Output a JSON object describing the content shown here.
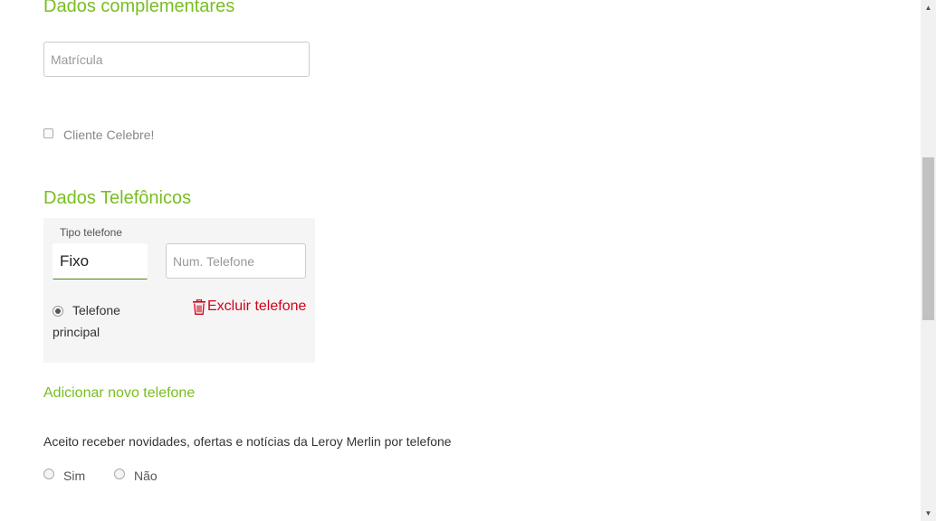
{
  "complementares": {
    "title": "Dados complementares",
    "matricula_placeholder": "Matrícula",
    "cliente_celebre_label": "Cliente Celebre!"
  },
  "telefonicos": {
    "title": "Dados Telefônicos",
    "tipo_label": "Tipo telefone",
    "tipo_value": "Fixo",
    "numero_placeholder": "Num. Telefone",
    "principal_label_line1": "Telefone",
    "principal_label_line2": "principal",
    "excluir_label": "Excluir telefone",
    "add_phone_label": "Adicionar novo telefone"
  },
  "consent": {
    "text": "Aceito receber novidades, ofertas e notícias da Leroy Merlin por telefone",
    "option_yes": "Sim",
    "option_no": "Não"
  },
  "colors": {
    "accent": "#78be20",
    "danger": "#d0021b",
    "card_bg": "#f5f5f5"
  },
  "icons": [
    "trash-icon",
    "scroll-up-arrow-icon",
    "scroll-down-arrow-icon"
  ]
}
